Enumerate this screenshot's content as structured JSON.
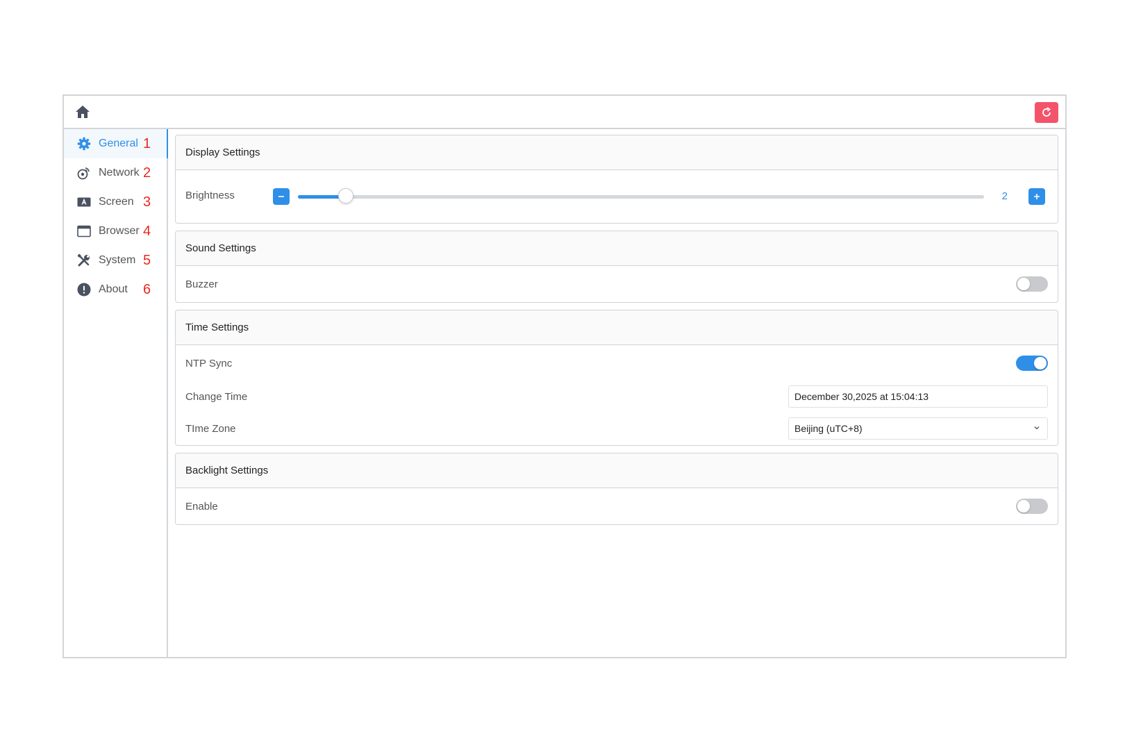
{
  "colors": {
    "accent": "#2f8fe8",
    "danger": "#f4546a",
    "border": "#d2d4d8",
    "annotation": "#e8281e"
  },
  "topbar": {
    "home_icon": "home-icon",
    "refresh_icon": "refresh-icon"
  },
  "sidebar": {
    "items": [
      {
        "label": "General",
        "icon": "gear-icon",
        "num": "1",
        "active": true
      },
      {
        "label": "Network",
        "icon": "network-icon",
        "num": "2",
        "active": false
      },
      {
        "label": "Screen",
        "icon": "screen-icon",
        "num": "3",
        "active": false
      },
      {
        "label": "Browser",
        "icon": "browser-window-icon",
        "num": "4",
        "active": false
      },
      {
        "label": "System",
        "icon": "tools-icon",
        "num": "5",
        "active": false
      },
      {
        "label": "About",
        "icon": "info-icon",
        "num": "6",
        "active": false
      }
    ]
  },
  "display": {
    "title": "Display Settings",
    "brightness_label": "Brightness",
    "brightness_value": "2",
    "brightness_fraction": 0.07
  },
  "sound": {
    "title": "Sound Settings",
    "buzzer_label": "Buzzer",
    "buzzer_on": false
  },
  "time": {
    "title": "Time Settings",
    "ntp_label": "NTP Sync",
    "ntp_on": true,
    "change_time_label": "Change Time",
    "change_time_value": "December 30,2025 at 15:04:13",
    "timezone_label": "TIme Zone",
    "timezone_value": "Beijing (uTC+8)"
  },
  "backlight": {
    "title": "Backlight Settings",
    "enable_label": "Enable",
    "enable_on": false
  }
}
